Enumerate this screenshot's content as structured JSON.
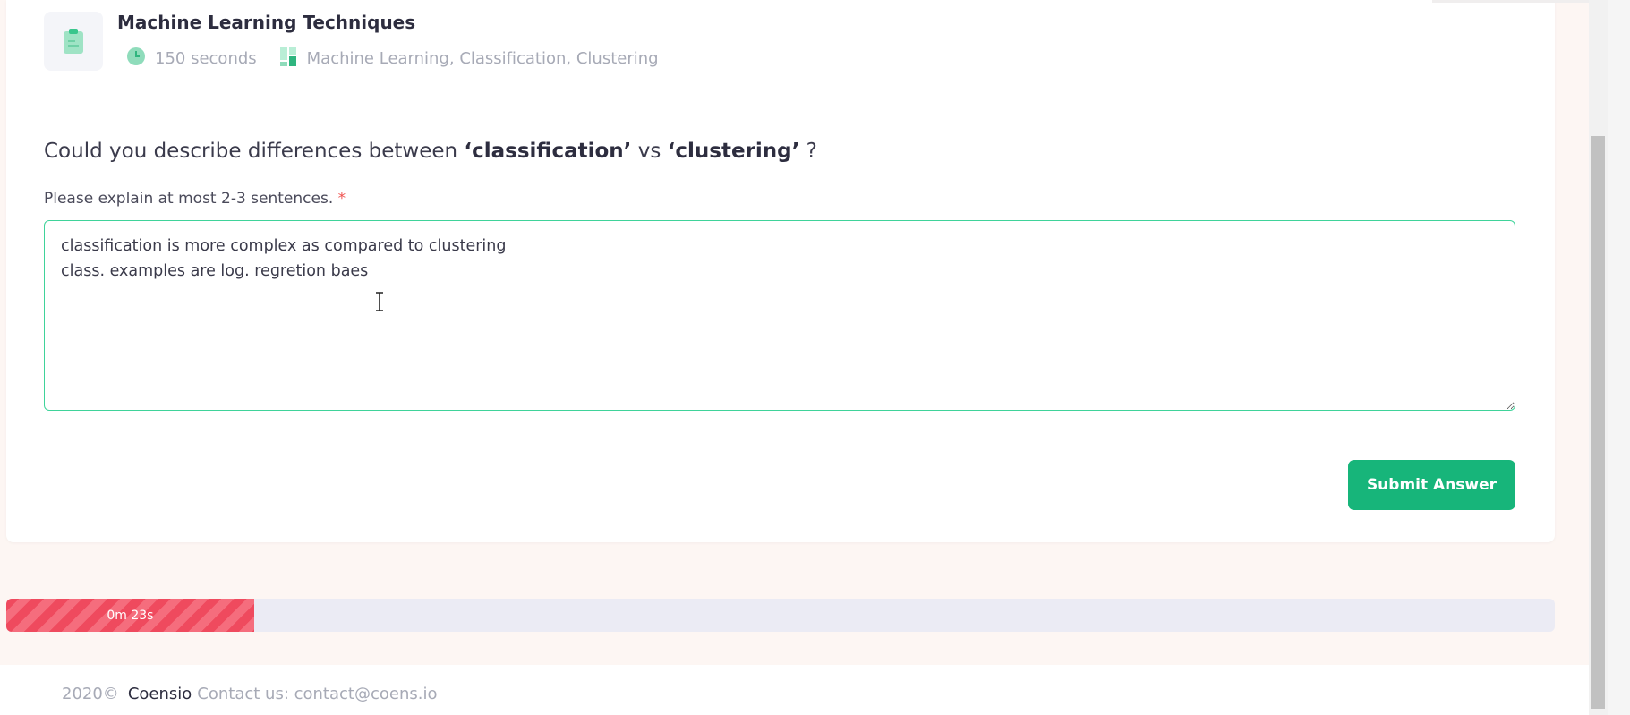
{
  "question_card": {
    "title": "Machine Learning Techniques",
    "duration": "150 seconds",
    "tags": "Machine Learning, Classification, Clustering",
    "question_prefix": "Could you describe differences between ",
    "term_one": "‘classification’",
    "question_mid": " vs ",
    "term_two": "‘clustering’",
    "question_suffix": " ?",
    "instruction": "Please explain at most 2-3 sentences.",
    "required_mark": "*",
    "answer_value": "classification is more complex as compared to clustering\nclass. examples are log. regretion baes",
    "submit_label": "Submit Answer"
  },
  "timer": {
    "label": "0m 23s",
    "progress_fraction": 0.16
  },
  "footer": {
    "year": "2020©",
    "brand": "Coensio",
    "contact": "Contact us: contact@coens.io"
  },
  "colors": {
    "accent": "#17b57a",
    "timer_fill": "#ef4a5e",
    "required": "#ef5350"
  },
  "icons": {
    "header": "clipboard-icon",
    "duration": "clock-icon",
    "tags": "category-icon"
  }
}
